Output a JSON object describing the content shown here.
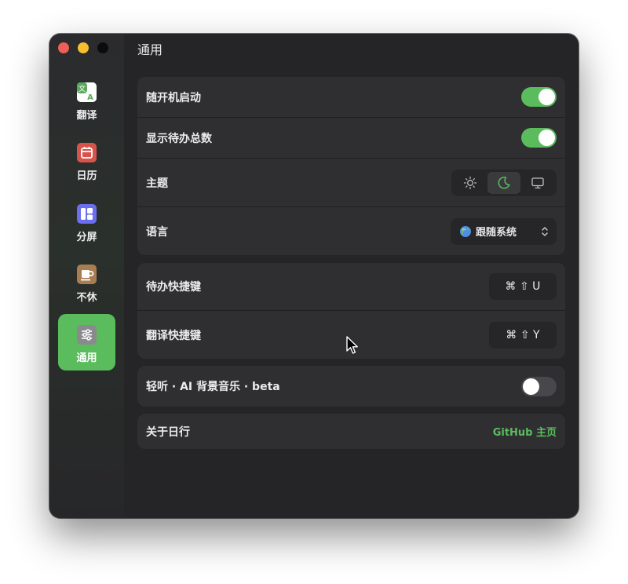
{
  "window": {
    "title": "通用"
  },
  "sidebar": {
    "items": [
      {
        "label": "翻译",
        "icon": "translate-icon",
        "color": "#55a05a"
      },
      {
        "label": "日历",
        "icon": "calendar-icon",
        "color": "#d6544c"
      },
      {
        "label": "分屏",
        "icon": "split-screen-icon",
        "color": "#6b6ef0"
      },
      {
        "label": "不休",
        "icon": "coffee-icon",
        "color": "#a87d52"
      },
      {
        "label": "通用",
        "icon": "sliders-icon",
        "color": "#8a8a8e",
        "active": true
      }
    ]
  },
  "settings": {
    "launch_at_login": {
      "label": "随开机启动",
      "enabled": true
    },
    "show_todo_count": {
      "label": "显示待办总数",
      "enabled": true
    },
    "theme": {
      "label": "主题",
      "options": [
        "sun-icon",
        "moon-icon",
        "monitor-icon"
      ],
      "selected": "moon-icon"
    },
    "language": {
      "label": "语言",
      "value": "跟随系统"
    },
    "todo_shortcut": {
      "label": "待办快捷键",
      "keys": "⌘ ⇧ U"
    },
    "translate_shortcut": {
      "label": "翻译快捷键",
      "keys": "⌘ ⇧ Y"
    },
    "ai_music": {
      "label": "轻听 · AI 背景音乐 · beta",
      "enabled": false
    },
    "about": {
      "label": "关于日行",
      "link": "GitHub 主页"
    }
  },
  "colors": {
    "accent": "#5bbc5e",
    "window_bg": "#252528",
    "card_bg": "#2f2f32"
  }
}
